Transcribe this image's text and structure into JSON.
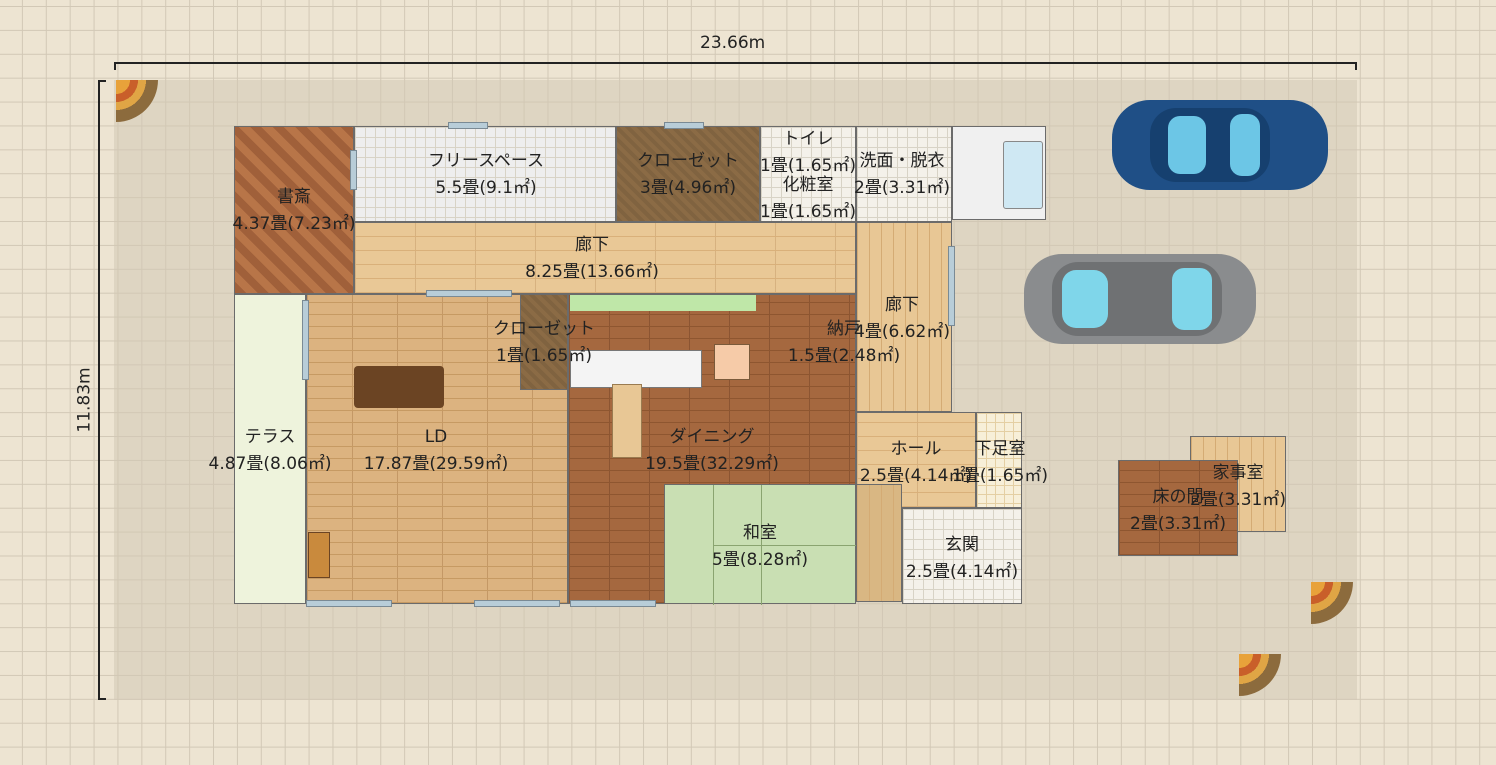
{
  "dimensions": {
    "width": "23.66m",
    "height": "11.83m"
  },
  "rooms": [
    {
      "id": "study",
      "name": "書斎",
      "area": "4.37畳(7.23㎡)"
    },
    {
      "id": "free-space",
      "name": "フリースペース",
      "area": "5.5畳(9.1㎡)"
    },
    {
      "id": "closet-top",
      "name": "クローゼット",
      "area": "3畳(4.96㎡)"
    },
    {
      "id": "toilet",
      "name": "トイレ",
      "area": "1畳(1.65㎡)"
    },
    {
      "id": "powder",
      "name": "化粧室",
      "area": "1畳(1.65㎡)"
    },
    {
      "id": "washroom",
      "name": "洗面・脱衣",
      "area": "2畳(3.31㎡)"
    },
    {
      "id": "hall-top",
      "name": "廊下",
      "area": "8.25畳(13.66㎡)"
    },
    {
      "id": "hall-right",
      "name": "廊下",
      "area": "4畳(6.62㎡)"
    },
    {
      "id": "storage",
      "name": "納戸",
      "area": "1.5畳(2.48㎡)"
    },
    {
      "id": "closet-mid",
      "name": "クローゼット",
      "area": "1畳(1.65㎡)"
    },
    {
      "id": "terrace",
      "name": "テラス",
      "area": "4.87畳(8.06㎡)"
    },
    {
      "id": "ld",
      "name": "LD",
      "area": "17.87畳(29.59㎡)"
    },
    {
      "id": "dining",
      "name": "ダイニング",
      "area": "19.5畳(32.29㎡)"
    },
    {
      "id": "washitsu",
      "name": "和室",
      "area": "5畳(8.28㎡)"
    },
    {
      "id": "hole",
      "name": "ホール",
      "area": "2.5畳(4.14㎡)"
    },
    {
      "id": "shoe-room",
      "name": "下足室",
      "area": "1畳(1.65㎡)"
    },
    {
      "id": "entrance",
      "name": "玄関",
      "area": "2.5畳(4.14㎡)"
    },
    {
      "id": "housework",
      "name": "家事室",
      "area": "2畳(3.31㎡)"
    },
    {
      "id": "tokonoma",
      "name": "床の間",
      "area": "2畳(3.31㎡)"
    }
  ],
  "colors": {
    "grid": "#d2c8b6",
    "background": "#ede4d2",
    "car_blue": "#1f4f86",
    "car_gray": "#8a8c8e"
  },
  "icons": [
    "car-blue-icon",
    "car-gray-icon",
    "plant-icon",
    "sofa-icon",
    "kitchen-icon"
  ]
}
